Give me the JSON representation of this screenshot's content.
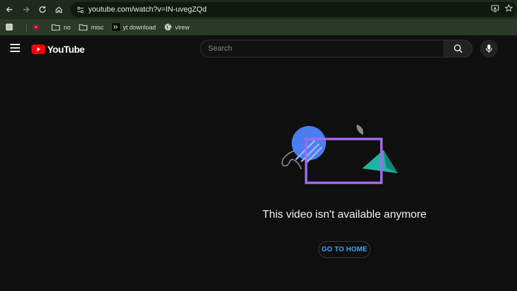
{
  "browser": {
    "url": "youtube.com/watch?v=IN-uvegZQd",
    "bookmarks": [
      {
        "label": "",
        "icon": "blank-page-icon"
      },
      {
        "label": "",
        "icon": "youtube-favicon"
      },
      {
        "label": "no",
        "icon": "folder-icon"
      },
      {
        "label": "misc",
        "icon": "folder-icon"
      },
      {
        "label": "yt download",
        "icon": "terminal-icon"
      },
      {
        "label": "virew",
        "icon": "globe-icon"
      }
    ]
  },
  "header": {
    "logo_text": "YouTube",
    "search_placeholder": "Search"
  },
  "main": {
    "message": "This video isn't available anymore",
    "home_button": "GO TO HOME"
  },
  "colors": {
    "accent_blue": "#3ea6ff",
    "youtube_red": "#ff0000",
    "frame_purple": "#a56bf0",
    "circle_blue": "#4a7df0",
    "triangle_teal": "#1fb5a3"
  }
}
